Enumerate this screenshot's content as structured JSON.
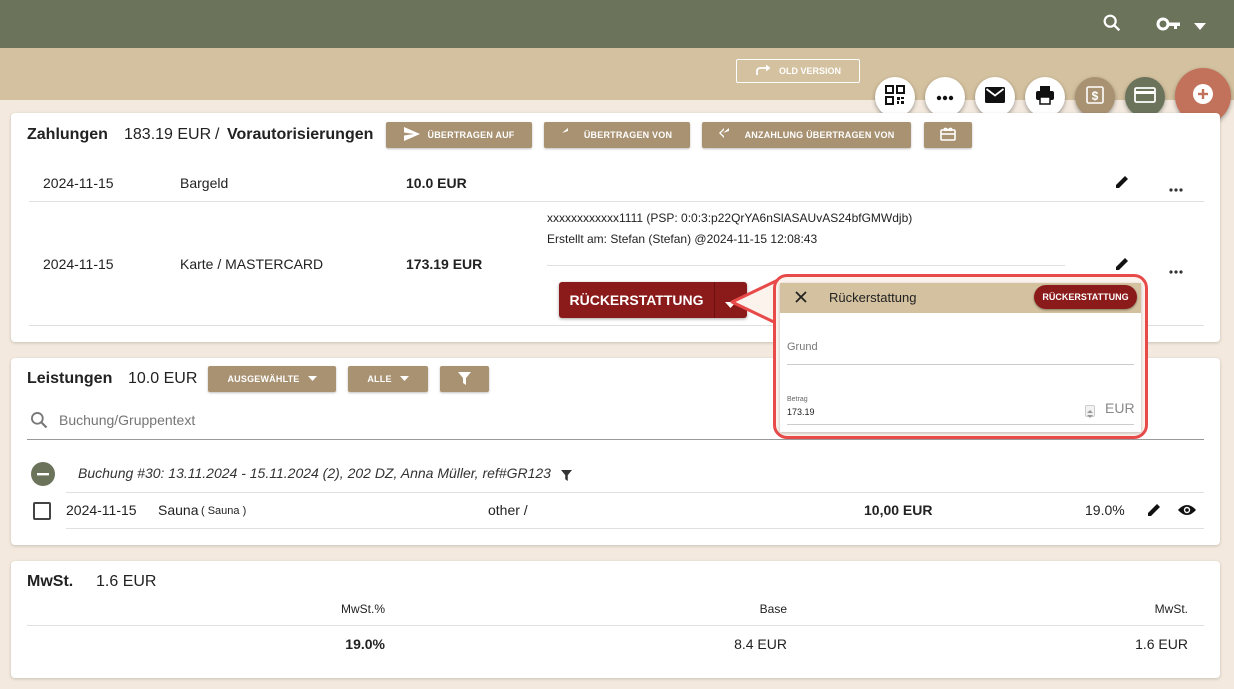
{
  "header": {
    "old_version_label": "OLD VERSION"
  },
  "payments": {
    "title": "Zahlungen",
    "amount": "183.19 EUR",
    "separator": "/",
    "preauth_label": "Vorautorisierungen",
    "btn_transfer_to": "ÜBERTRAGEN AUF",
    "btn_transfer_from": "ÜBERTRAGEN VON",
    "btn_deposit_transfer": "ANZAHLUNG ÜBERTRAGEN VON",
    "rows": [
      {
        "date": "2024-11-15",
        "method": "Bargeld",
        "amount": "10.0 EUR"
      },
      {
        "date": "2024-11-15",
        "method": "Karte / MASTERCARD",
        "amount": "173.19 EUR",
        "card_info": "xxxxxxxxxxxx1111 (PSP: 0:0:3:p22QrYA6nSlASAUvAS24bfGMWdjb)",
        "created_prefix": "Erstellt am: ",
        "created_value": "Stefan (Stefan) @2024-11-15 12:08:43",
        "refund_button": "RÜCKERSTATTUNG"
      }
    ]
  },
  "refund_popup": {
    "title": "Rückerstattung",
    "action_button": "RÜCKERSTATTUNG",
    "reason_label": "Grund",
    "amount_label": "Betrag",
    "amount_value": "173.19",
    "currency": "EUR",
    "highlight_color": "#e84a4a"
  },
  "services": {
    "title": "Leistungen",
    "amount": "10.0 EUR",
    "btn_selected": "AUSGEWÄHLTE",
    "btn_all": "ALLE",
    "search_placeholder": "Buchung/Gruppentext",
    "booking_label": "Buchung #30: 13.11.2024 - 15.11.2024 (2), 202 DZ, Anna Müller, ref#GR123",
    "items": [
      {
        "date": "2024-11-15",
        "name": "Sauna",
        "sub": "( Sauna )",
        "category": "other /",
        "amount": "10,00 EUR",
        "vat": "19.0%"
      }
    ]
  },
  "vat": {
    "title": "MwSt.",
    "amount": "1.6 EUR",
    "headers": [
      "MwSt.%",
      "Base",
      "MwSt."
    ],
    "rows": [
      {
        "rate": "19.0%",
        "base": "8.4 EUR",
        "tax": "1.6 EUR"
      }
    ]
  },
  "colors": {
    "topbar": "#6b735b",
    "subbar": "#d3c19f",
    "tan_button": "#a99272",
    "refund_red": "#8b1a1a",
    "fab_add": "#c2715a",
    "background": "#f3e9de"
  }
}
